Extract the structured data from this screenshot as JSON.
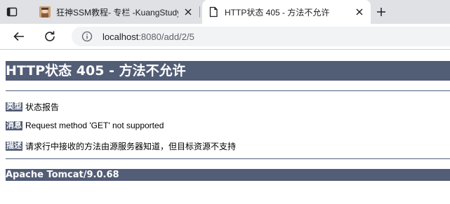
{
  "browser": {
    "tabs": [
      {
        "title": "狂神SSM教程- 专栏 -KuangStudy",
        "favicon": "avatar-favicon",
        "active": false
      },
      {
        "title": "HTTP状态 405 - 方法不允许",
        "favicon": "page-icon",
        "active": true
      }
    ],
    "address": {
      "host": "localhost",
      "rest": ":8080/add/2/5"
    }
  },
  "page": {
    "heading": "HTTP状态 405 - 方法不允许",
    "type_label": "类型",
    "type_value": "状态报告",
    "message_label": "消息",
    "message_value": "Request method 'GET' not supported",
    "description_label": "描述",
    "description_value": "请求行中接收的方法由源服务器知道，但目标资源不支持",
    "footer": "Apache Tomcat/9.0.68"
  },
  "colors": {
    "tomcat_bar": "#525d76",
    "tabstrip": "#dfe1e5",
    "omnibox": "#f1f3f4"
  }
}
